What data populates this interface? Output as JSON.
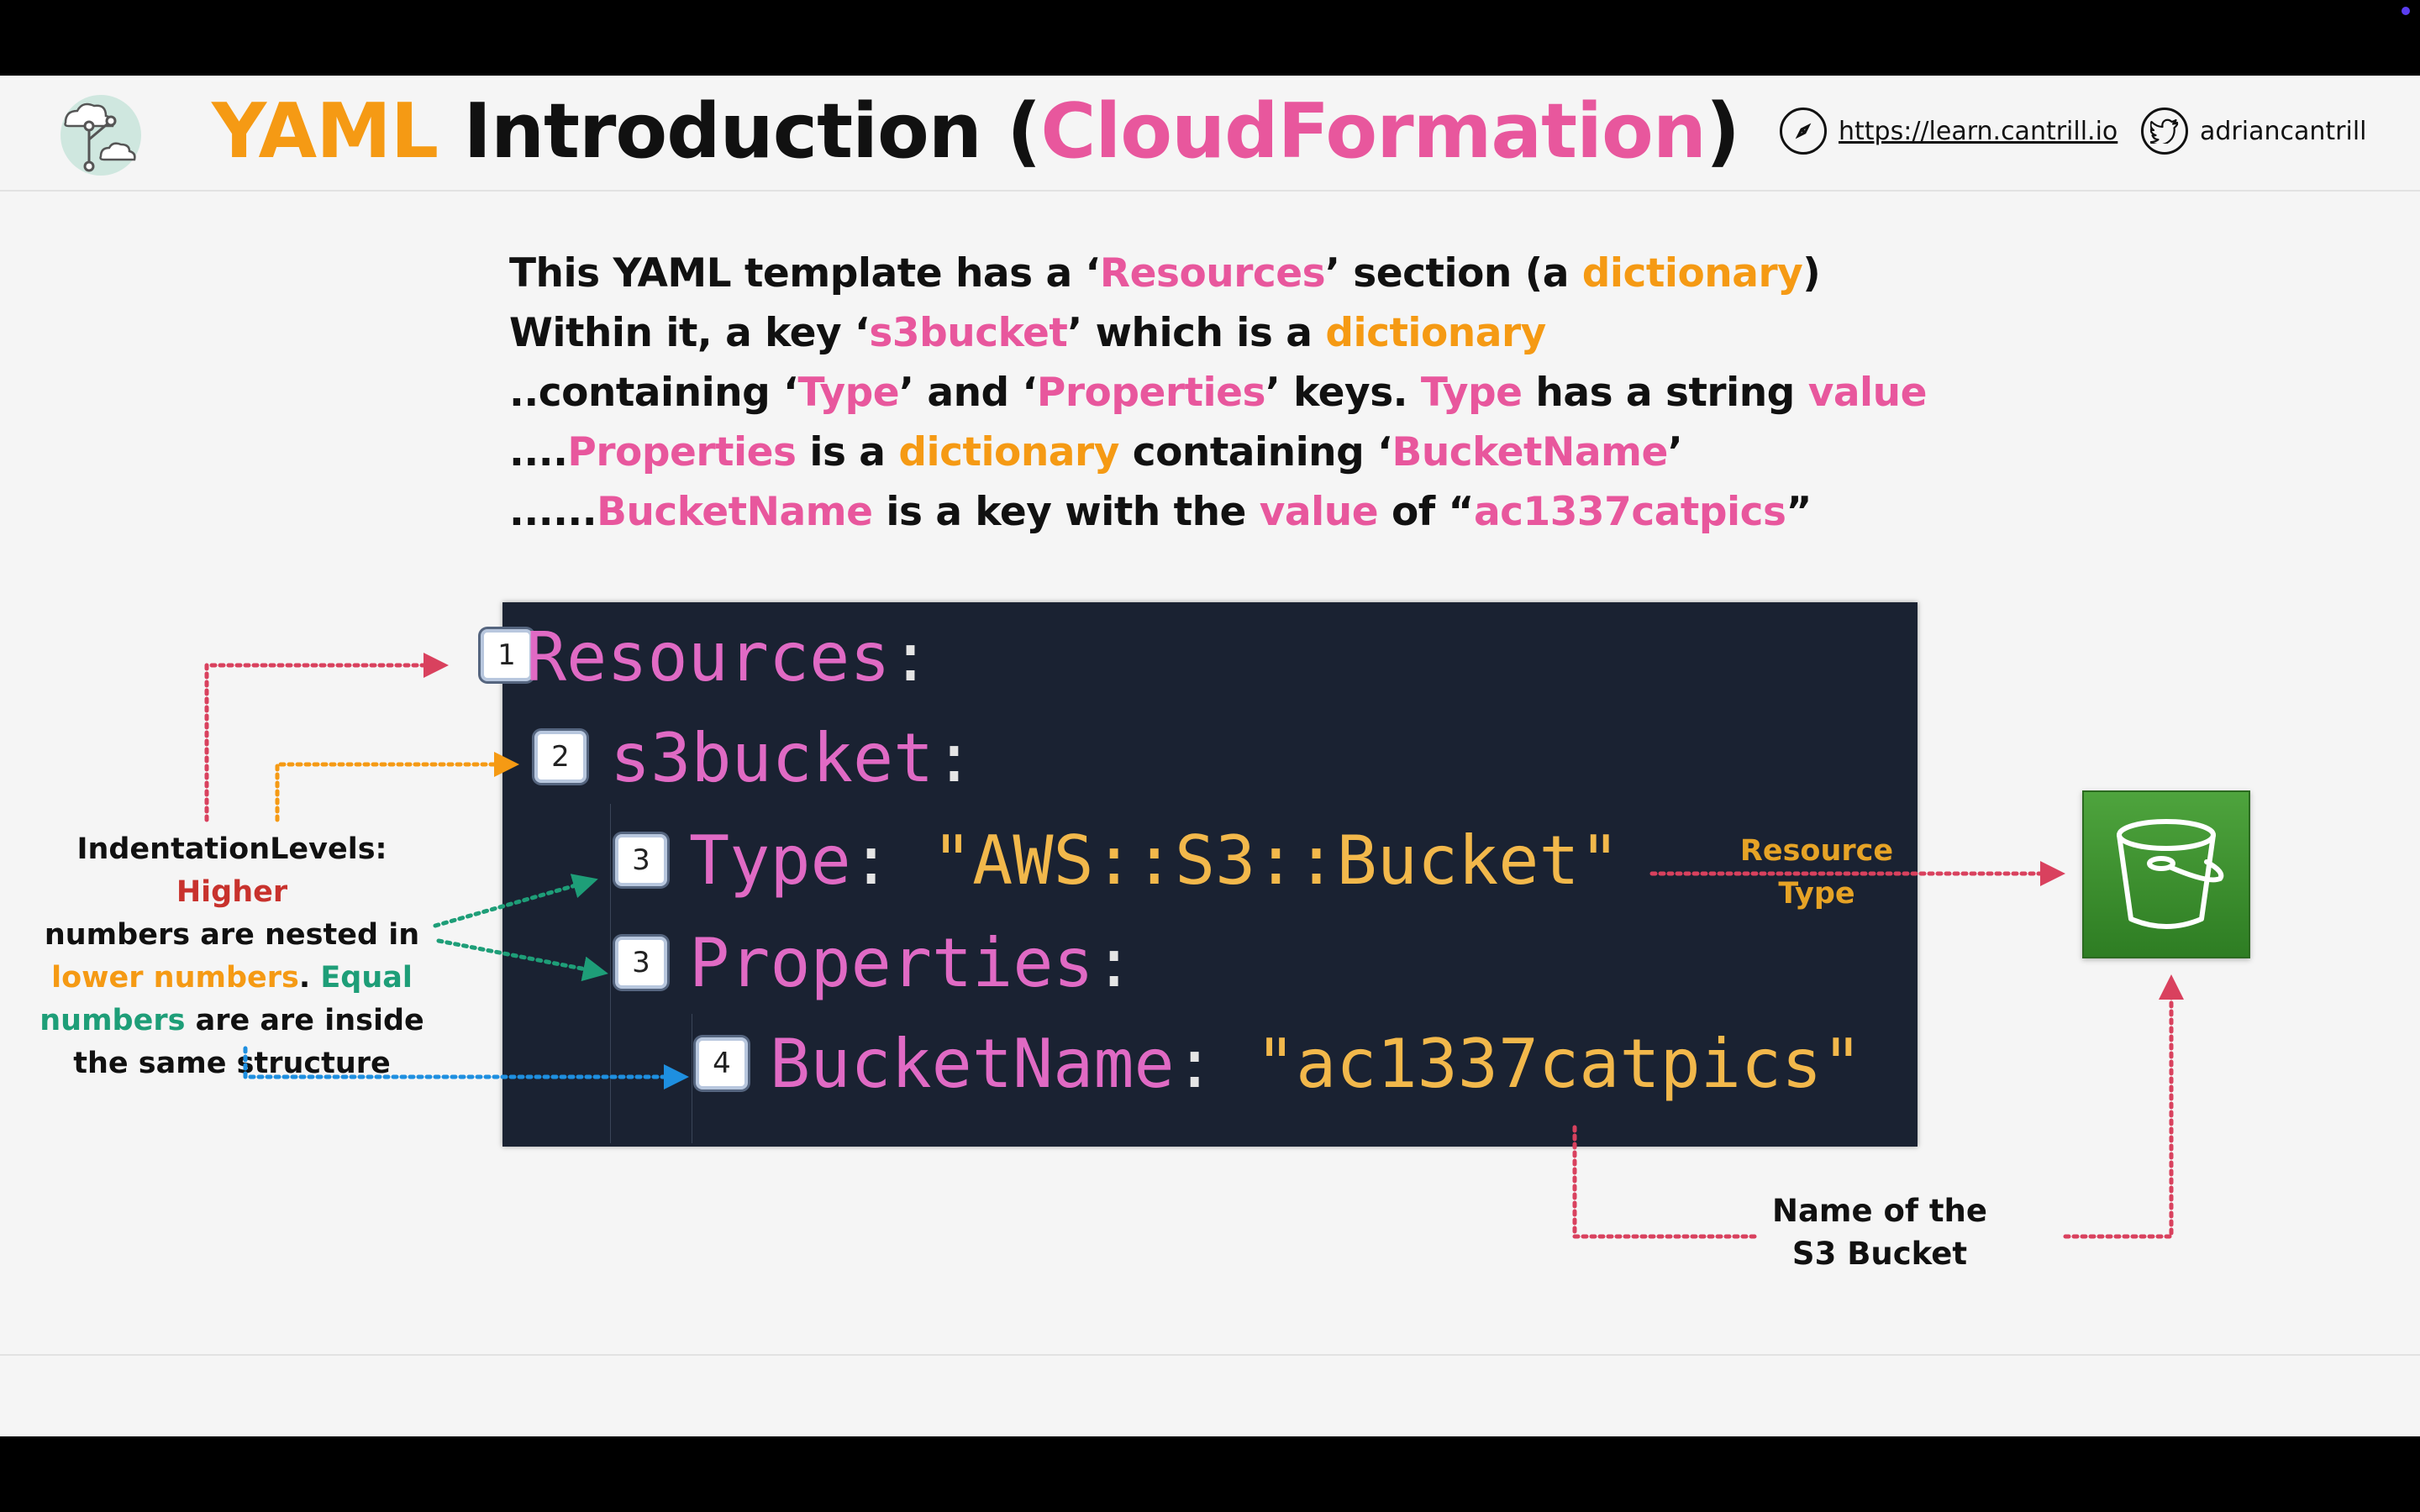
{
  "header": {
    "title_part1": "YAML",
    "title_part2": " Introduction (",
    "title_part3": "CloudFormation",
    "title_part4": ")",
    "site_link": "https://learn.cantrill.io",
    "twitter_handle": "adriancantrill",
    "logo_icon": "network-cloud-logo",
    "site_icon": "compass-icon",
    "twitter_icon": "twitter-bird-icon"
  },
  "description": {
    "line1": [
      "This YAML template has a ‘",
      "Resources",
      "’ section (a ",
      "dictionary",
      ")"
    ],
    "line2": [
      "Within it, a key ‘",
      "s3bucket",
      "’ which is a ",
      "dictionary"
    ],
    "line3": [
      "..containing ‘",
      "Type",
      "’ and ‘",
      "Properties",
      "’ keys. ",
      "Type",
      " has a string ",
      "value"
    ],
    "line4": [
      "....",
      "Properties",
      " is a ",
      "dictionary",
      " containing ‘",
      "BucketName",
      "’"
    ],
    "line5": [
      "......",
      "BucketName",
      " is a key with the ",
      "value",
      " of “",
      "ac1337catpics",
      "”"
    ]
  },
  "code": {
    "lines": [
      {
        "level": "1",
        "key": "Resources",
        "colon": ":",
        "value": ""
      },
      {
        "level": "2",
        "key": "s3bucket",
        "colon": ":",
        "value": ""
      },
      {
        "level": "3",
        "key": "Type",
        "colon": ": ",
        "value": "\"AWS::S3::Bucket\""
      },
      {
        "level": "3",
        "key": "Properties",
        "colon": ":",
        "value": ""
      },
      {
        "level": "4",
        "key": "BucketName",
        "colon": ": ",
        "value": "\"ac1337catpics\""
      }
    ]
  },
  "legend": {
    "part1": "IndentationLevels: ",
    "part2": "Higher",
    "part3": "numbers are nested in",
    "part4": "lower numbers",
    "part5": ". ",
    "part6": "Equal",
    "part7": "numbers",
    "part8": " are are inside",
    "part9": "the same structure"
  },
  "annotations": {
    "resource_type_line1": "Resource",
    "resource_type_line2": "Type",
    "bucket_name_line1": "Name of the",
    "bucket_name_line2": "S3 Bucket",
    "s3_icon": "s3-bucket-icon"
  },
  "colors": {
    "orange": "#f59a14",
    "pink": "#e8579d",
    "code_bg": "#1a2232",
    "green": "#1e9e78",
    "blue": "#1e8fe0",
    "red_arrow": "#d9415e"
  }
}
